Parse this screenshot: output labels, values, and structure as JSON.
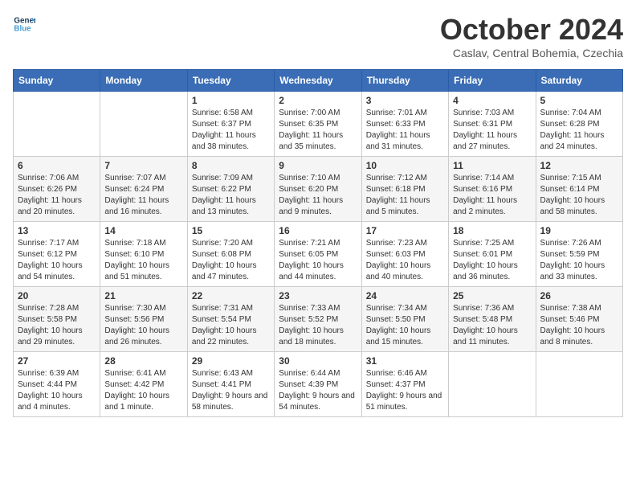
{
  "logo": {
    "line1": "General",
    "line2": "Blue"
  },
  "title": "October 2024",
  "subtitle": "Caslav, Central Bohemia, Czechia",
  "days_header": [
    "Sunday",
    "Monday",
    "Tuesday",
    "Wednesday",
    "Thursday",
    "Friday",
    "Saturday"
  ],
  "weeks": [
    [
      {
        "day": "",
        "sunrise": "",
        "sunset": "",
        "daylight": ""
      },
      {
        "day": "",
        "sunrise": "",
        "sunset": "",
        "daylight": ""
      },
      {
        "day": "1",
        "sunrise": "Sunrise: 6:58 AM",
        "sunset": "Sunset: 6:37 PM",
        "daylight": "Daylight: 11 hours and 38 minutes."
      },
      {
        "day": "2",
        "sunrise": "Sunrise: 7:00 AM",
        "sunset": "Sunset: 6:35 PM",
        "daylight": "Daylight: 11 hours and 35 minutes."
      },
      {
        "day": "3",
        "sunrise": "Sunrise: 7:01 AM",
        "sunset": "Sunset: 6:33 PM",
        "daylight": "Daylight: 11 hours and 31 minutes."
      },
      {
        "day": "4",
        "sunrise": "Sunrise: 7:03 AM",
        "sunset": "Sunset: 6:31 PM",
        "daylight": "Daylight: 11 hours and 27 minutes."
      },
      {
        "day": "5",
        "sunrise": "Sunrise: 7:04 AM",
        "sunset": "Sunset: 6:28 PM",
        "daylight": "Daylight: 11 hours and 24 minutes."
      }
    ],
    [
      {
        "day": "6",
        "sunrise": "Sunrise: 7:06 AM",
        "sunset": "Sunset: 6:26 PM",
        "daylight": "Daylight: 11 hours and 20 minutes."
      },
      {
        "day": "7",
        "sunrise": "Sunrise: 7:07 AM",
        "sunset": "Sunset: 6:24 PM",
        "daylight": "Daylight: 11 hours and 16 minutes."
      },
      {
        "day": "8",
        "sunrise": "Sunrise: 7:09 AM",
        "sunset": "Sunset: 6:22 PM",
        "daylight": "Daylight: 11 hours and 13 minutes."
      },
      {
        "day": "9",
        "sunrise": "Sunrise: 7:10 AM",
        "sunset": "Sunset: 6:20 PM",
        "daylight": "Daylight: 11 hours and 9 minutes."
      },
      {
        "day": "10",
        "sunrise": "Sunrise: 7:12 AM",
        "sunset": "Sunset: 6:18 PM",
        "daylight": "Daylight: 11 hours and 5 minutes."
      },
      {
        "day": "11",
        "sunrise": "Sunrise: 7:14 AM",
        "sunset": "Sunset: 6:16 PM",
        "daylight": "Daylight: 11 hours and 2 minutes."
      },
      {
        "day": "12",
        "sunrise": "Sunrise: 7:15 AM",
        "sunset": "Sunset: 6:14 PM",
        "daylight": "Daylight: 10 hours and 58 minutes."
      }
    ],
    [
      {
        "day": "13",
        "sunrise": "Sunrise: 7:17 AM",
        "sunset": "Sunset: 6:12 PM",
        "daylight": "Daylight: 10 hours and 54 minutes."
      },
      {
        "day": "14",
        "sunrise": "Sunrise: 7:18 AM",
        "sunset": "Sunset: 6:10 PM",
        "daylight": "Daylight: 10 hours and 51 minutes."
      },
      {
        "day": "15",
        "sunrise": "Sunrise: 7:20 AM",
        "sunset": "Sunset: 6:08 PM",
        "daylight": "Daylight: 10 hours and 47 minutes."
      },
      {
        "day": "16",
        "sunrise": "Sunrise: 7:21 AM",
        "sunset": "Sunset: 6:05 PM",
        "daylight": "Daylight: 10 hours and 44 minutes."
      },
      {
        "day": "17",
        "sunrise": "Sunrise: 7:23 AM",
        "sunset": "Sunset: 6:03 PM",
        "daylight": "Daylight: 10 hours and 40 minutes."
      },
      {
        "day": "18",
        "sunrise": "Sunrise: 7:25 AM",
        "sunset": "Sunset: 6:01 PM",
        "daylight": "Daylight: 10 hours and 36 minutes."
      },
      {
        "day": "19",
        "sunrise": "Sunrise: 7:26 AM",
        "sunset": "Sunset: 5:59 PM",
        "daylight": "Daylight: 10 hours and 33 minutes."
      }
    ],
    [
      {
        "day": "20",
        "sunrise": "Sunrise: 7:28 AM",
        "sunset": "Sunset: 5:58 PM",
        "daylight": "Daylight: 10 hours and 29 minutes."
      },
      {
        "day": "21",
        "sunrise": "Sunrise: 7:30 AM",
        "sunset": "Sunset: 5:56 PM",
        "daylight": "Daylight: 10 hours and 26 minutes."
      },
      {
        "day": "22",
        "sunrise": "Sunrise: 7:31 AM",
        "sunset": "Sunset: 5:54 PM",
        "daylight": "Daylight: 10 hours and 22 minutes."
      },
      {
        "day": "23",
        "sunrise": "Sunrise: 7:33 AM",
        "sunset": "Sunset: 5:52 PM",
        "daylight": "Daylight: 10 hours and 18 minutes."
      },
      {
        "day": "24",
        "sunrise": "Sunrise: 7:34 AM",
        "sunset": "Sunset: 5:50 PM",
        "daylight": "Daylight: 10 hours and 15 minutes."
      },
      {
        "day": "25",
        "sunrise": "Sunrise: 7:36 AM",
        "sunset": "Sunset: 5:48 PM",
        "daylight": "Daylight: 10 hours and 11 minutes."
      },
      {
        "day": "26",
        "sunrise": "Sunrise: 7:38 AM",
        "sunset": "Sunset: 5:46 PM",
        "daylight": "Daylight: 10 hours and 8 minutes."
      }
    ],
    [
      {
        "day": "27",
        "sunrise": "Sunrise: 6:39 AM",
        "sunset": "Sunset: 4:44 PM",
        "daylight": "Daylight: 10 hours and 4 minutes."
      },
      {
        "day": "28",
        "sunrise": "Sunrise: 6:41 AM",
        "sunset": "Sunset: 4:42 PM",
        "daylight": "Daylight: 10 hours and 1 minute."
      },
      {
        "day": "29",
        "sunrise": "Sunrise: 6:43 AM",
        "sunset": "Sunset: 4:41 PM",
        "daylight": "Daylight: 9 hours and 58 minutes."
      },
      {
        "day": "30",
        "sunrise": "Sunrise: 6:44 AM",
        "sunset": "Sunset: 4:39 PM",
        "daylight": "Daylight: 9 hours and 54 minutes."
      },
      {
        "day": "31",
        "sunrise": "Sunrise: 6:46 AM",
        "sunset": "Sunset: 4:37 PM",
        "daylight": "Daylight: 9 hours and 51 minutes."
      },
      {
        "day": "",
        "sunrise": "",
        "sunset": "",
        "daylight": ""
      },
      {
        "day": "",
        "sunrise": "",
        "sunset": "",
        "daylight": ""
      }
    ]
  ]
}
